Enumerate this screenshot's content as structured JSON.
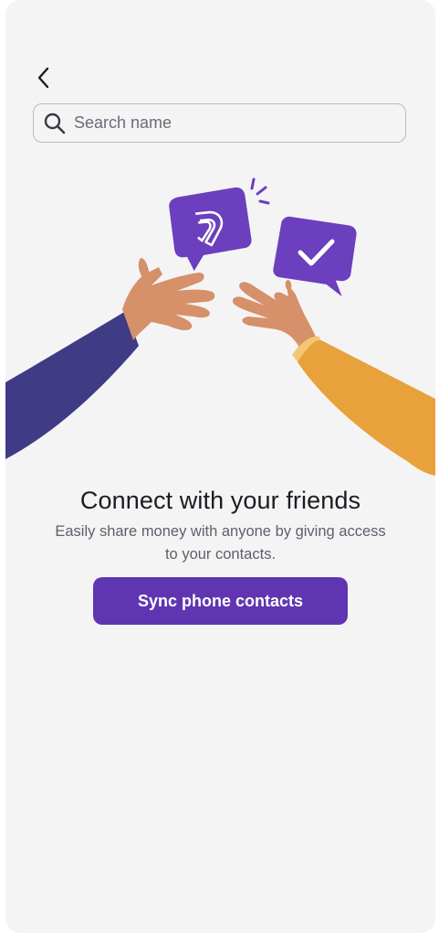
{
  "header": {
    "back_icon": "chevron-left-icon"
  },
  "search": {
    "placeholder": "Search name",
    "value": "",
    "icon": "search-icon"
  },
  "illustration": {
    "icons": [
      "brand-logo-icon",
      "checkmark-icon"
    ],
    "colors": {
      "bubble": "#6b3fbd",
      "left_sleeve": "#3f3b85",
      "right_sleeve": "#e9a13b",
      "skin": "#d6906a"
    }
  },
  "content": {
    "title": "Connect with your friends",
    "subtitle": "Easily share money with anyone by giving access to your contacts."
  },
  "actions": {
    "sync_label": "Sync phone contacts"
  },
  "theme": {
    "accent": "#6035b2",
    "background": "#f4f4f5"
  }
}
